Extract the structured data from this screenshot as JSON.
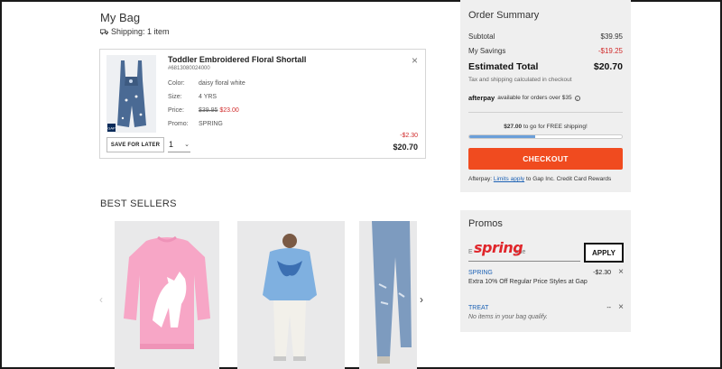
{
  "bag": {
    "title": "My Bag",
    "shipping": "Shipping: 1 item"
  },
  "item": {
    "name": "Toddler Embroidered Floral Shortall",
    "sku": "#6813080024000",
    "color_label": "Color:",
    "color_value": "daisy floral white",
    "size_label": "Size:",
    "size_value": "4 YRS",
    "price_label": "Price:",
    "original_price": "$39.95",
    "sale_price": "$23.00",
    "promo_label": "Promo:",
    "promo_value": "SPRING",
    "save_for_later": "SAVE FOR LATER",
    "quantity": "1",
    "discount": "-$2.30",
    "total": "$20.70",
    "brand_mark": "GAP"
  },
  "best_sellers": {
    "title": "BEST SELLERS",
    "prev": "‹",
    "next": "›"
  },
  "summary": {
    "title": "Order Summary",
    "subtotal_label": "Subtotal",
    "subtotal_value": "$39.95",
    "savings_label": "My Savings",
    "savings_value": "-$19.25",
    "total_label": "Estimated Total",
    "total_value": "$20.70",
    "tax_note": "Tax and shipping calculated in checkout",
    "afterpay_logo": "afterpay",
    "afterpay_text": "available for orders over $35",
    "shipping_amount": "$27.00",
    "shipping_msg": "to go for FREE shipping!",
    "shipping_progress": 0.43,
    "checkout": "CHECKOUT",
    "afterpay_prefix": "Afterpay:",
    "afterpay_link": "Limits apply",
    "afterpay_suffix": "to Gap Inc. Credit Card Rewards"
  },
  "promos": {
    "title": "Promos",
    "input_label_start": "E",
    "input_label_end": "ode",
    "spring_logo": "spring",
    "apply": "APPLY",
    "codes": [
      {
        "code": "SPRING",
        "desc": "Extra 10% Off Regular Price Styles at Gap",
        "amount": "-$2.30"
      },
      {
        "code": "TREAT",
        "desc": "No items in your bag qualify.",
        "amount": "--"
      }
    ]
  },
  "colors": {
    "checkout": "#f04b1f",
    "sale": "#d12b2b",
    "link": "#1d62b5",
    "progress": "#6b9fd9"
  }
}
